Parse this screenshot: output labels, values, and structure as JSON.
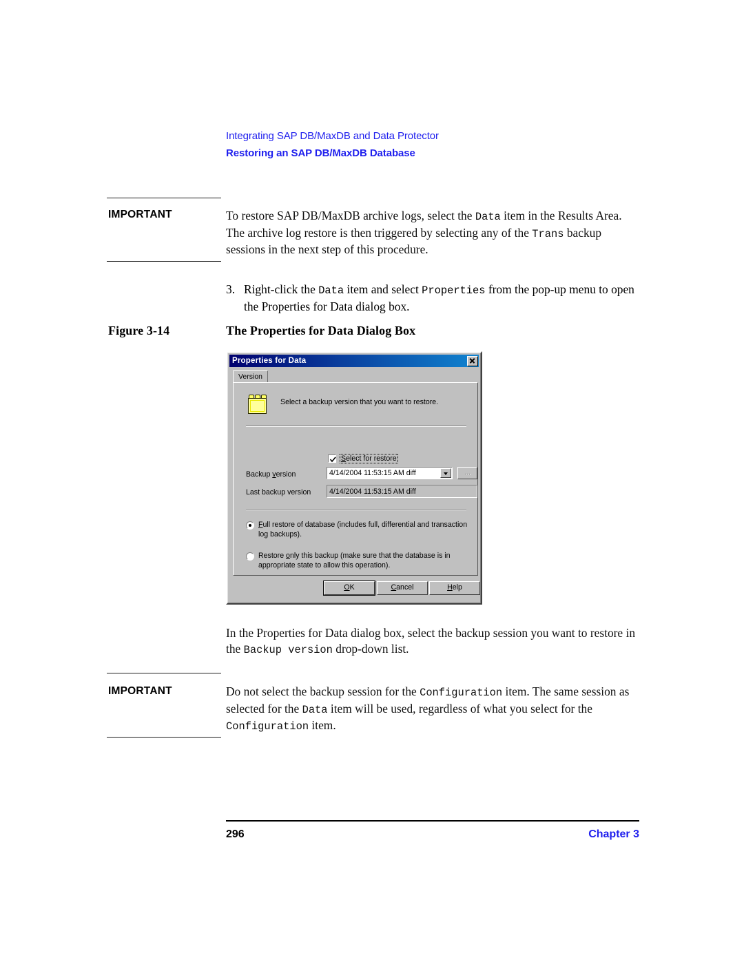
{
  "running_head": {
    "section": "Integrating SAP DB/MaxDB and Data Protector",
    "subsection": "Restoring an SAP DB/MaxDB Database"
  },
  "notes": {
    "important_label": "IMPORTANT",
    "note1_part1": "To restore SAP DB/MaxDB archive logs, select the ",
    "note1_code1": "Data",
    "note1_part2": " item in the Results Area. The archive log restore is then triggered by selecting any of the ",
    "note1_code2": "Trans",
    "note1_part3": " backup sessions in the next step of this procedure.",
    "note2_part1": "Do not select the backup session for the ",
    "note2_code1": "Configuration",
    "note2_part2": " item. The same session as selected for the ",
    "note2_code2": "Data",
    "note2_part3": " item will be used, regardless of what you select for the ",
    "note2_code3": "Configuration",
    "note2_part4": " item."
  },
  "step": {
    "number": "3.",
    "part1": "Right-click the ",
    "code1": "Data",
    "part2": " item and select ",
    "code2": "Properties",
    "part3": " from the pop-up menu to open the Properties for Data dialog box."
  },
  "figure": {
    "label": "Figure 3-14",
    "title": "The Properties for Data Dialog Box"
  },
  "after_figure": {
    "part1": "In the Properties for Data dialog box, select the backup session you want to restore in the ",
    "code1": "Backup version",
    "part2": " drop-down list."
  },
  "dialog": {
    "title": "Properties for Data",
    "close_label": "Close",
    "tab_label": "Version",
    "instruction": "Select a backup version that you want to restore.",
    "checkbox": {
      "label_prefix": "S",
      "label_rest": "elect for restore",
      "checked": true
    },
    "backup_version": {
      "label_pre": "Backup ",
      "label_mnemonic": "v",
      "label_post": "ersion",
      "value": "4/14/2004 11:53:15 AM diff"
    },
    "browse_button": "...",
    "last_backup_version": {
      "label": "Last backup version",
      "value": "4/14/2004 11:53:15 AM diff"
    },
    "radios": [
      {
        "mnemonic": "F",
        "text": "ull restore of database (includes full, differential and transaction log backups).",
        "selected": true
      },
      {
        "pre": "Restore ",
        "mnemonic": "o",
        "text": "nly this backup (make sure that the database is in appropriate state to allow this operation).",
        "selected": false
      }
    ],
    "buttons": {
      "ok_mnemonic": "O",
      "ok_rest": "K",
      "cancel_mnemonic": "C",
      "cancel_rest": "ancel",
      "help_mnemonic": "H",
      "help_rest": "elp"
    }
  },
  "footer": {
    "page_number": "296",
    "chapter": "Chapter 3"
  },
  "colors": {
    "heading_blue": "#2020ee",
    "title_bar_left": "#00006e",
    "title_bar_right": "#1084d0",
    "dialog_face": "#c0c0c0",
    "icon_yellow": "#ffff9c"
  }
}
